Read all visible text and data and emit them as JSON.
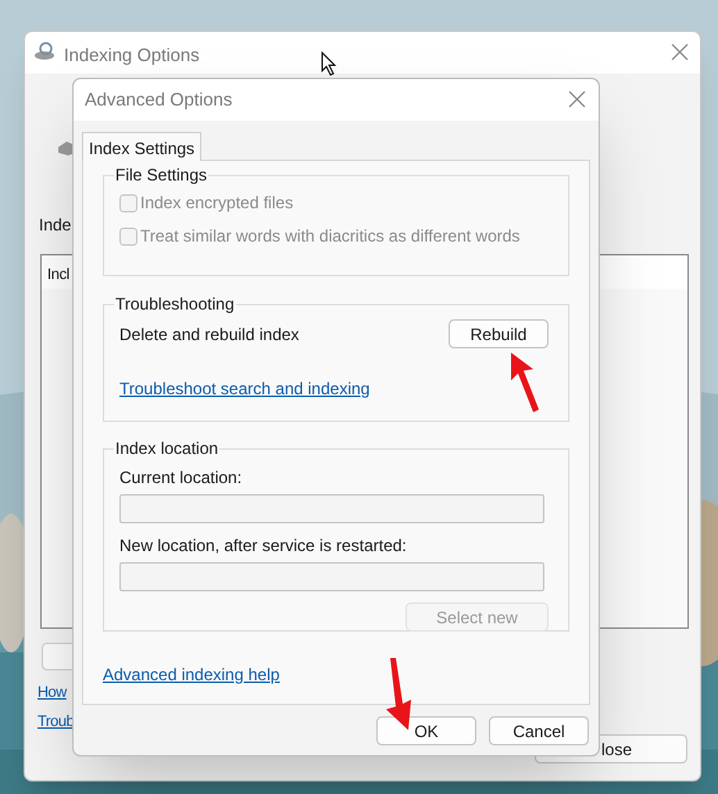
{
  "back_window": {
    "title": "Indexing Options",
    "label": "Inde",
    "list_header": "Incl",
    "links": [
      "How",
      "Troub"
    ],
    "close_button": "lose"
  },
  "dialog": {
    "title": "Advanced Options",
    "tabs": [
      {
        "label": "Index Settings",
        "selected": true
      }
    ],
    "file_settings": {
      "title": "File Settings",
      "checkboxes": [
        {
          "label": "Index encrypted files",
          "checked": false,
          "disabled": true
        },
        {
          "label": "Treat similar words with diacritics as different words",
          "checked": false,
          "disabled": true
        }
      ]
    },
    "troubleshooting": {
      "title": "Troubleshooting",
      "text": "Delete and rebuild index",
      "button": "Rebuild",
      "link": "Troubleshoot search and indexing"
    },
    "index_location": {
      "title": "Index location",
      "current_label": "Current location:",
      "new_label": "New location, after service is restarted:",
      "button": {
        "label": "Select new",
        "disabled": true
      }
    },
    "help_link": "Advanced indexing help",
    "buttons": [
      "OK",
      "Cancel"
    ]
  }
}
